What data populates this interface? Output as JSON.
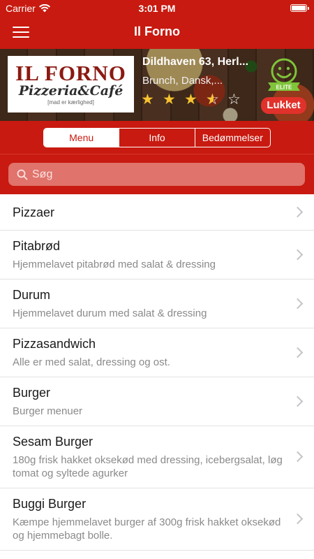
{
  "status_bar": {
    "carrier": "Carrier",
    "time": "3:01 PM"
  },
  "nav": {
    "title": "Il Forno"
  },
  "restaurant": {
    "logo_main": "IL FORNO",
    "logo_sub": "Pizzeria&Café",
    "logo_tagline": "[mad er kærlighed]",
    "address": "Dildhaven 63, Herl...",
    "cuisine": "Brunch, Dansk,...",
    "rating": 3.5,
    "rating_max": 5,
    "elite_label": "ELITE",
    "status": "Lukket"
  },
  "tabs": [
    {
      "label": "Menu",
      "active": true
    },
    {
      "label": "Info",
      "active": false
    },
    {
      "label": "Bedømmelser",
      "active": false
    }
  ],
  "search": {
    "placeholder": "Søg"
  },
  "categories": [
    {
      "title": "Pizzaer",
      "description": ""
    },
    {
      "title": "Pitabrød",
      "description": "Hjemmelavet pitabrød med salat & dressing"
    },
    {
      "title": "Durum",
      "description": "Hjemmelavet durum med salat & dressing"
    },
    {
      "title": "Pizzasandwich",
      "description": "Alle er med salat, dressing og ost."
    },
    {
      "title": "Burger",
      "description": "Burger menuer"
    },
    {
      "title": "Sesam Burger",
      "description": "180g frisk hakket oksekød med dressing, icebergsalat, løg tomat og syltede agurker"
    },
    {
      "title": "Buggi Burger",
      "description": "Kæmpe hjemmelavet burger af 300g frisk hakket oksekød og hjemmebagt bolle."
    }
  ],
  "colors": {
    "brand_red": "#c81a10",
    "star_gold": "#f7c330",
    "closed_red": "#e0312b",
    "elite_green": "#7fc43a"
  }
}
